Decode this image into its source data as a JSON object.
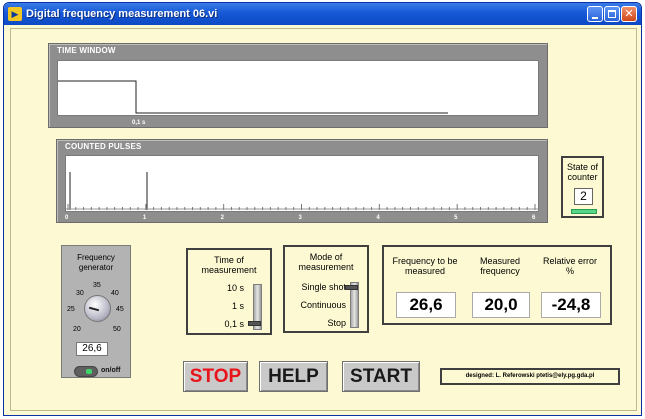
{
  "window": {
    "title": "Digital frequency measurement 06.vi"
  },
  "time_window": {
    "title": "TIME WINDOW",
    "tick_label": "0,1 s"
  },
  "counted_pulses": {
    "title": "COUNTED PULSES",
    "x_ticks": [
      "0",
      "1",
      "2",
      "3",
      "4",
      "5",
      "6"
    ]
  },
  "state_of_counter": {
    "label": "State of counter",
    "value": "2"
  },
  "frequency_generator": {
    "label": "Frequency generator",
    "scale": [
      "20",
      "25",
      "30",
      "35",
      "40",
      "45",
      "50"
    ],
    "value": "26,6",
    "switch_label": "on/off"
  },
  "time_of_measurement": {
    "label": "Time of measurement",
    "options": [
      "10 s",
      "1 s",
      "0,1 s"
    ],
    "selected": "0,1 s"
  },
  "mode_of_measurement": {
    "label": "Mode of measurement",
    "options": [
      "Single shot",
      "Continuous",
      "Stop"
    ],
    "selected": "Single shot"
  },
  "results": {
    "to_be_measured_label": "Frequency to be measured",
    "measured_label": "Measured frequency",
    "error_label": "Relative error %",
    "to_be_measured_value": "26,6",
    "measured_value": "20,0",
    "error_value": "-24,8"
  },
  "buttons": {
    "stop": "STOP",
    "help": "HELP",
    "start": "START"
  },
  "credit": "designed: L. Referowski ptetis@ely.pg.gda.pl",
  "colors": {
    "titlebar": "#1658d6",
    "panel_bg": "#fdfad3",
    "stop_red": "#e8141a",
    "led_green": "#54d887"
  }
}
